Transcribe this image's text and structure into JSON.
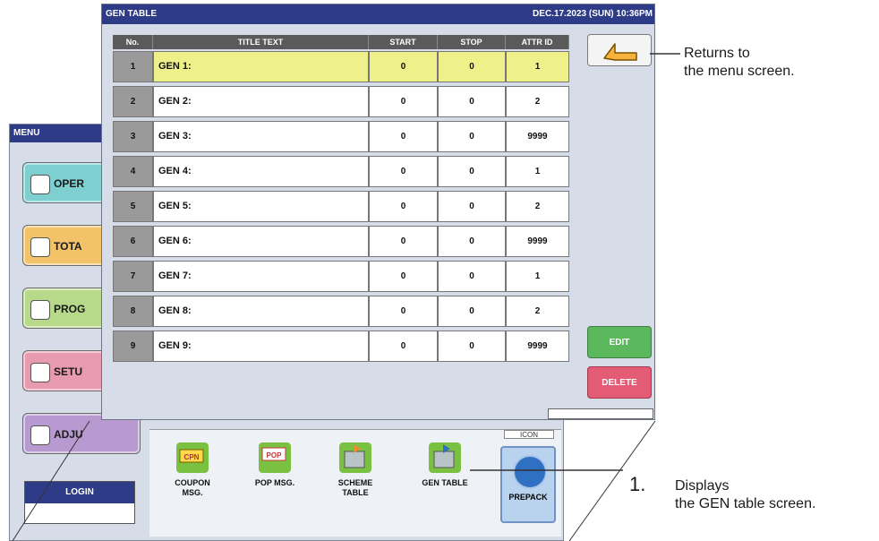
{
  "menu_window": {
    "title": "MENU",
    "buttons": [
      {
        "label": "OPER",
        "icon": "play-icon"
      },
      {
        "label": "TOTA",
        "icon": "clock-icon"
      },
      {
        "label": "PROG",
        "icon": "book-icon"
      },
      {
        "label": "SETU",
        "icon": "wrench-icon"
      },
      {
        "label": "ADJU",
        "icon": "triangle-icon"
      }
    ],
    "login_label": "LOGIN",
    "partial_tab": "ICON",
    "bottom_icons": [
      {
        "label_line1": "COUPON",
        "label_line2": "MSG.",
        "badge": "CPN",
        "color": "#7ac142"
      },
      {
        "label_line1": "POP MSG.",
        "label_line2": "",
        "badge": "POP",
        "color": "#7ac142"
      },
      {
        "label_line1": "SCHEME",
        "label_line2": "TABLE",
        "badge": "",
        "color": "#7ac142"
      },
      {
        "label_line1": "GEN TABLE",
        "label_line2": "",
        "badge": "",
        "color": "#7ac142"
      }
    ],
    "prepack_label": "PREPACK"
  },
  "gen_window": {
    "title": "GEN TABLE",
    "datetime": "DEC.17.2023 (SUN)  10:36PM",
    "columns": [
      "No.",
      "TITLE TEXT",
      "START",
      "STOP",
      "ATTR ID"
    ],
    "rows": [
      {
        "no": "1",
        "title": "GEN 1:",
        "start": "0",
        "stop": "0",
        "attr": "1"
      },
      {
        "no": "2",
        "title": "GEN 2:",
        "start": "0",
        "stop": "0",
        "attr": "2"
      },
      {
        "no": "3",
        "title": "GEN 3:",
        "start": "0",
        "stop": "0",
        "attr": "9999"
      },
      {
        "no": "4",
        "title": "GEN 4:",
        "start": "0",
        "stop": "0",
        "attr": "1"
      },
      {
        "no": "5",
        "title": "GEN 5:",
        "start": "0",
        "stop": "0",
        "attr": "2"
      },
      {
        "no": "6",
        "title": "GEN 6:",
        "start": "0",
        "stop": "0",
        "attr": "9999"
      },
      {
        "no": "7",
        "title": "GEN 7:",
        "start": "0",
        "stop": "0",
        "attr": "1"
      },
      {
        "no": "8",
        "title": "GEN 8:",
        "start": "0",
        "stop": "0",
        "attr": "2"
      },
      {
        "no": "9",
        "title": "GEN 9:",
        "start": "0",
        "stop": "0",
        "attr": "9999"
      }
    ],
    "edit_label": "EDIT",
    "delete_label": "DELETE",
    "selected_row_color": "#eef08a",
    "edit_color": "#5cb85c",
    "delete_color": "#e35b74"
  },
  "annotations": {
    "back_line1": "Returns to",
    "back_line2": "the menu screen.",
    "note1_number": "1.",
    "note1_line1": "Displays",
    "note1_line2": "the GEN table screen."
  }
}
